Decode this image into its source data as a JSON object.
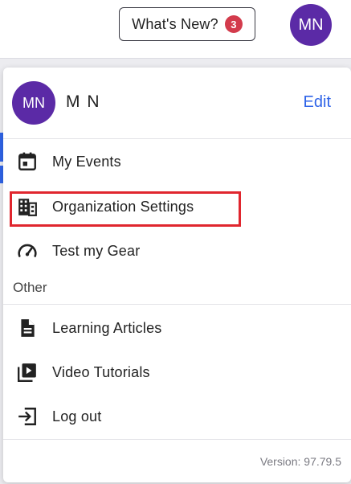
{
  "topbar": {
    "whats_new_label": "What's New?",
    "whats_new_count": "3",
    "avatar_initials": "MN"
  },
  "menu": {
    "avatar_initials": "MN",
    "user_name": "M N",
    "edit_label": "Edit",
    "items": [
      {
        "label": "My Events",
        "icon": "calendar-icon"
      },
      {
        "label": "Organization Settings",
        "icon": "building-icon"
      },
      {
        "label": "Test my Gear",
        "icon": "speedometer-icon"
      }
    ],
    "other_label": "Other",
    "other_items": [
      {
        "label": "Learning Articles",
        "icon": "document-icon"
      },
      {
        "label": "Video Tutorials",
        "icon": "video-library-icon"
      },
      {
        "label": "Log out",
        "icon": "logout-icon"
      }
    ],
    "version": "Version: 97.79.5"
  },
  "colors": {
    "avatar": "#5b2aa6",
    "link": "#2f64e8",
    "badge": "#d33b4c",
    "highlight": "#e0262e"
  }
}
